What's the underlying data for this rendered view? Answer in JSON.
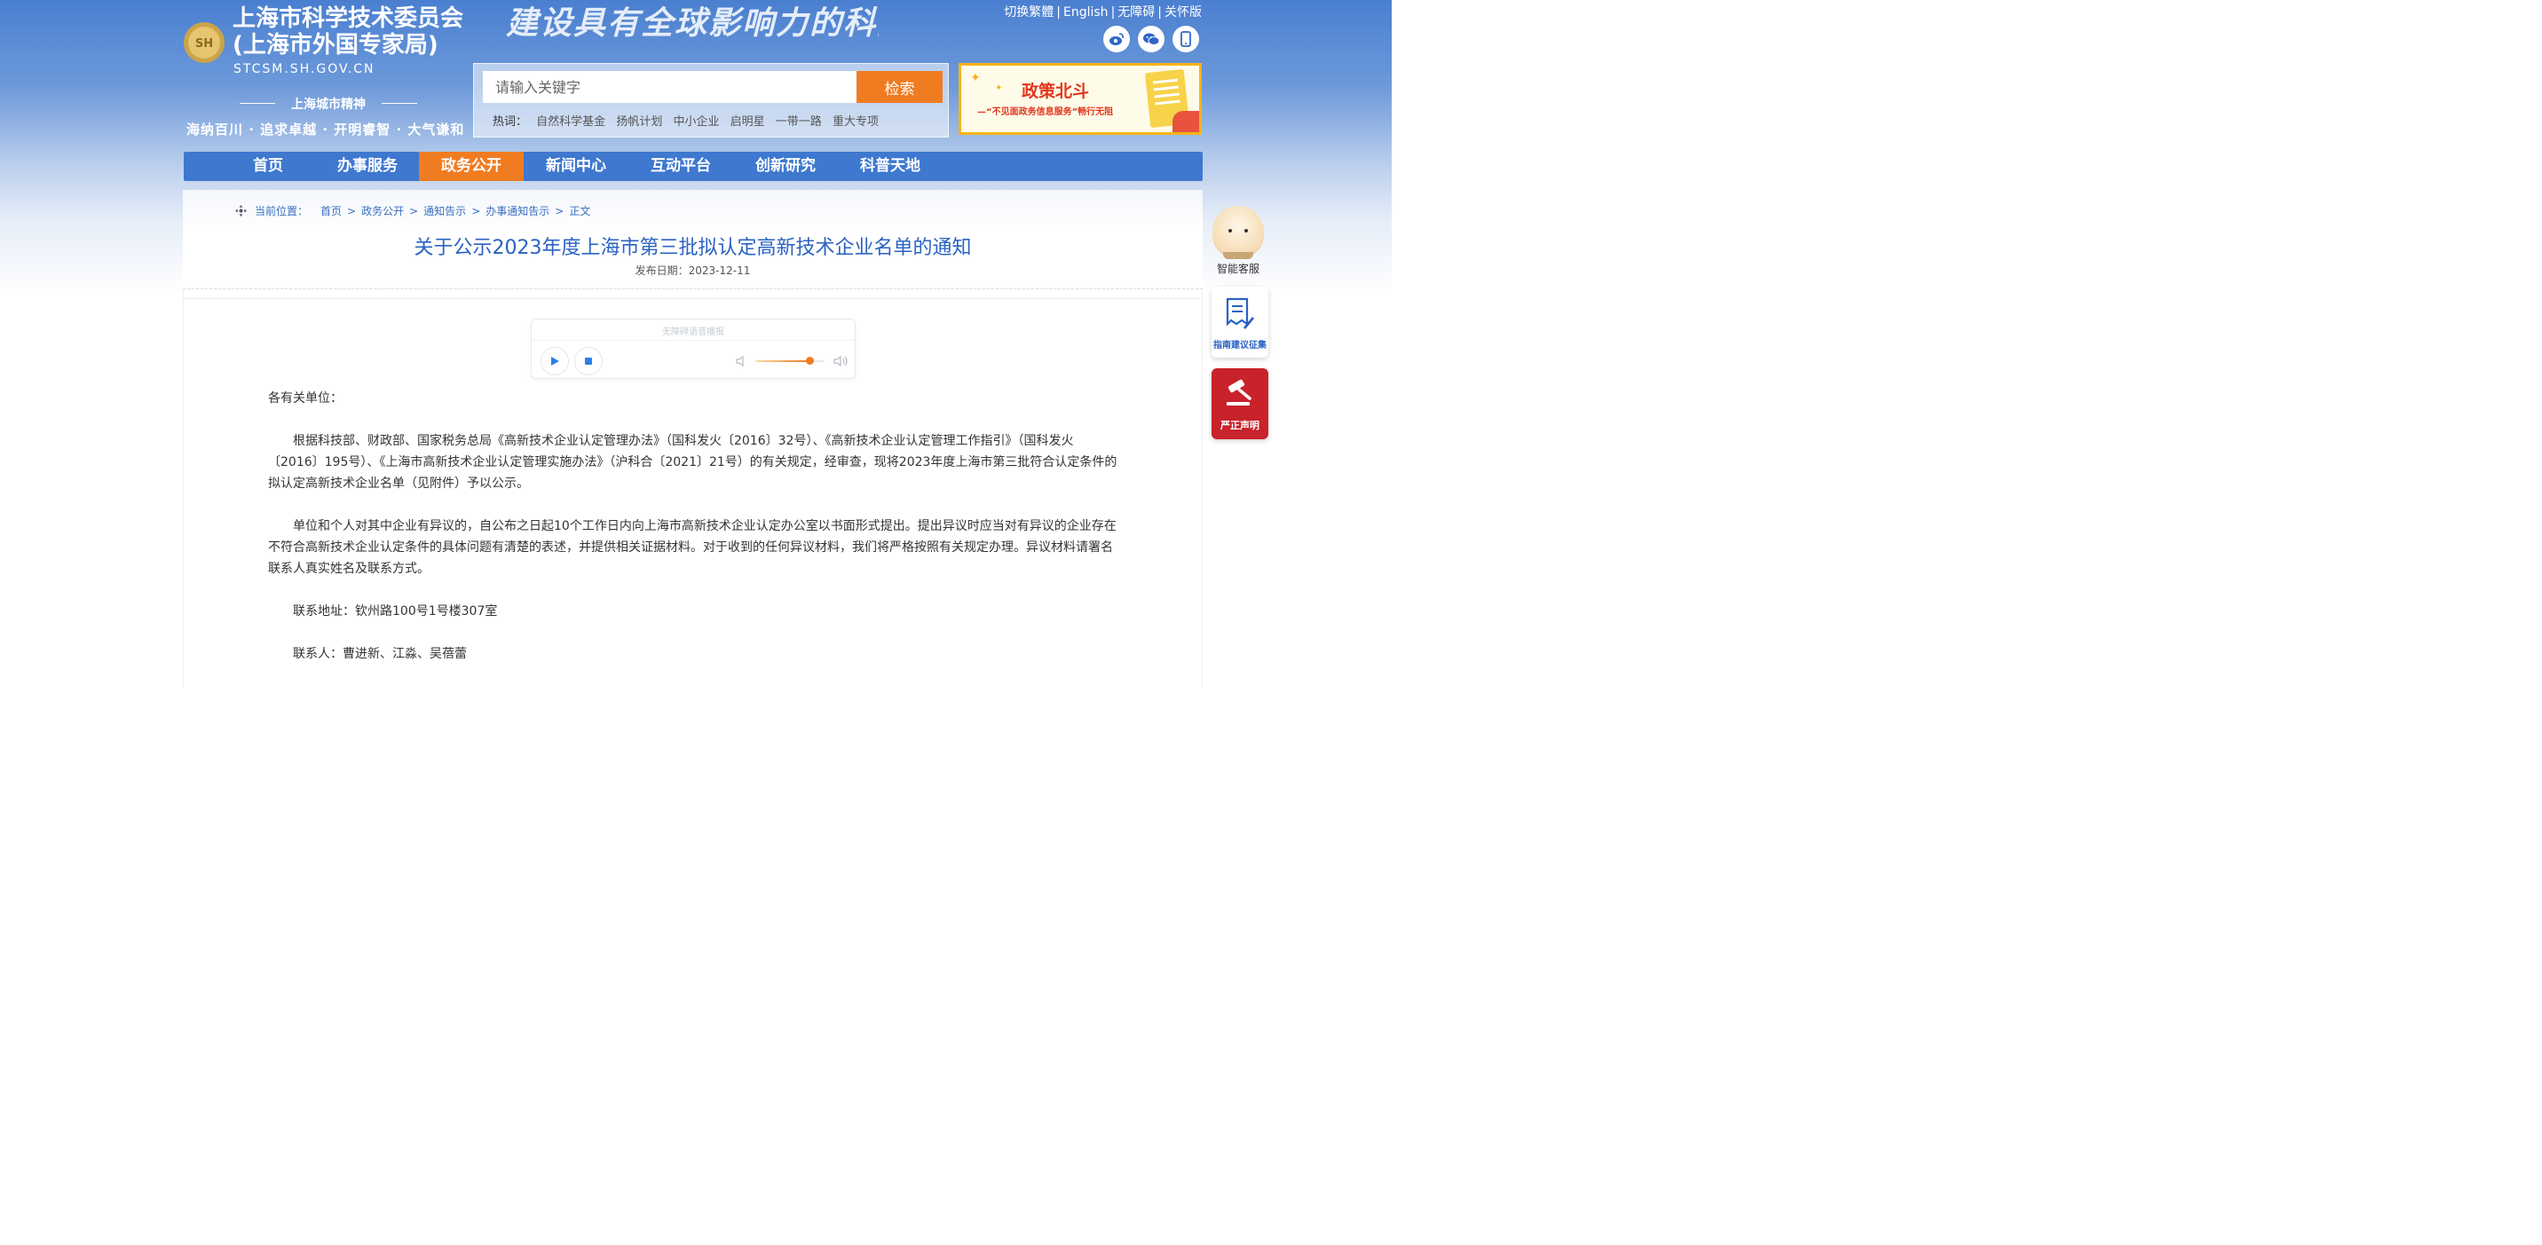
{
  "header": {
    "site_title_line1": "上海市科学技术委员会",
    "site_title_line2": "(上海市外国专家局)",
    "site_domain": "STCSM.SH.GOV.CN",
    "spirit_title": "上海城市精神",
    "spirit_text": "海纳百川 · 追求卓越 · 开明睿智 · 大气谦和",
    "banner_slogan": "建设具有全球影响力的科技",
    "logo_text": "SH",
    "top_links": [
      "切换繁體",
      "English",
      "无障碍",
      "关怀版"
    ],
    "social_icons": [
      "weibo-icon",
      "wechat-icon",
      "mobile-icon"
    ]
  },
  "search": {
    "placeholder": "请输入关键字",
    "button_label": "检索",
    "hot_label": "热词：",
    "hot_words": [
      "自然科学基金",
      "扬帆计划",
      "中小企业",
      "启明星",
      "一带一路",
      "重大专项"
    ]
  },
  "policy_banner": {
    "title": "政策北斗",
    "subtitle": "—“不见面政务信息服务”畅行无阻"
  },
  "nav": {
    "items": [
      {
        "label": "首页",
        "active": false
      },
      {
        "label": "办事服务",
        "active": false
      },
      {
        "label": "政务公开",
        "active": true
      },
      {
        "label": "新闻中心",
        "active": false
      },
      {
        "label": "互动平台",
        "active": false
      },
      {
        "label": "创新研究",
        "active": false
      },
      {
        "label": "科普天地",
        "active": false
      }
    ]
  },
  "breadcrumb": {
    "label": "当前位置：",
    "items": [
      "首页",
      "政务公开",
      "通知告示",
      "办事通知告示",
      "正文"
    ]
  },
  "article": {
    "title": "关于公示2023年度上海市第三批拟认定高新技术企业名单的通知",
    "date_label": "发布日期：",
    "date": "2023-12-11",
    "greeting": "各有关单位：",
    "paragraphs": [
      "根据科技部、财政部、国家税务总局《高新技术企业认定管理办法》（国科发火〔2016〕32号）、《高新技术企业认定管理工作指引》（国科发火〔2016〕195号）、《上海市高新技术企业认定管理实施办法》（沪科合〔2021〕21号）的有关规定，经审查，现将2023年度上海市第三批符合认定条件的拟认定高新技术企业名单（见附件）予以公示。",
      "单位和个人对其中企业有异议的，自公布之日起10个工作日内向上海市高新技术企业认定办公室以书面形式提出。提出异议时应当对有异议的企业存在不符合高新技术企业认定条件的具体问题有清楚的表述，并提供相关证据材料。对于收到的任何异议材料，我们将严格按照有关规定办理。异议材料请署名联系人真实姓名及联系方式。",
      "联系地址：钦州路100号1号楼307室",
      "联系人：曹进新、江淼、吴蓓蕾"
    ]
  },
  "audio_player": {
    "title": "无障碍语音播报",
    "volume": 0.78,
    "colors": {
      "accent": "#f07c22",
      "icon": "#2e7fe6"
    }
  },
  "side_tools": {
    "bot_label": "智能客服",
    "guide_label": "指南建议征集",
    "claim_label": "严正声明"
  },
  "colors": {
    "nav_bg": "#3e78cf",
    "nav_active": "#f07c22",
    "title_blue": "#2a62c2",
    "claim_red": "#c8222a"
  }
}
